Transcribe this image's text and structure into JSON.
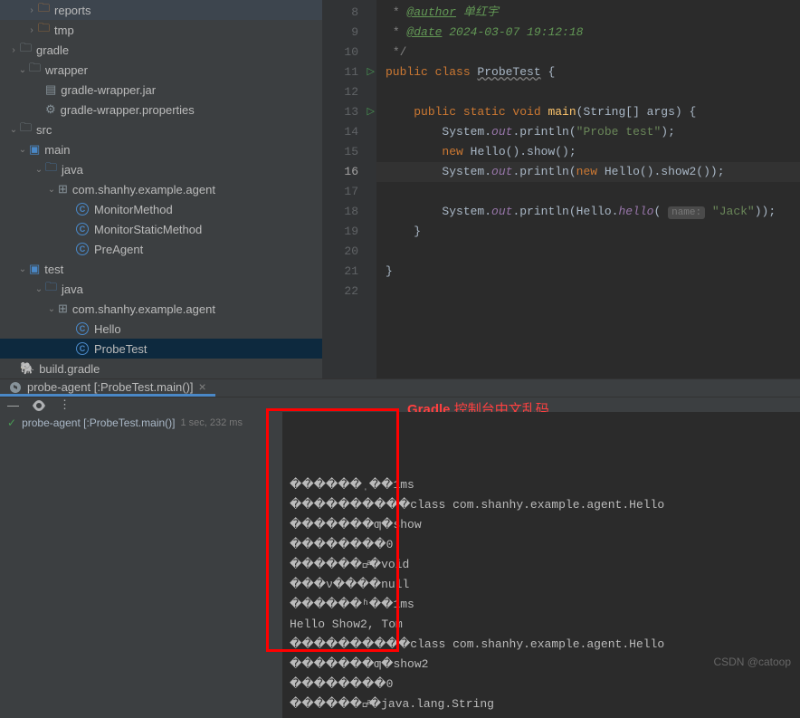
{
  "sidebar": {
    "items": [
      {
        "indent": 20,
        "chevron": "›",
        "icon": "folder-orange",
        "label": "reports"
      },
      {
        "indent": 20,
        "chevron": "›",
        "icon": "folder-orange",
        "label": "tmp"
      },
      {
        "indent": 0,
        "chevron": "›",
        "icon": "folder",
        "label": "gradle"
      },
      {
        "indent": 10,
        "chevron": "⌄",
        "icon": "folder",
        "label": "wrapper"
      },
      {
        "indent": 28,
        "chevron": "",
        "icon": "file",
        "label": "gradle-wrapper.jar"
      },
      {
        "indent": 28,
        "chevron": "",
        "icon": "gear",
        "label": "gradle-wrapper.properties"
      },
      {
        "indent": 0,
        "chevron": "⌄",
        "icon": "folder",
        "label": "src"
      },
      {
        "indent": 10,
        "chevron": "⌄",
        "icon": "module",
        "label": "main"
      },
      {
        "indent": 28,
        "chevron": "⌄",
        "icon": "folder-blue",
        "label": "java"
      },
      {
        "indent": 42,
        "chevron": "⌄",
        "icon": "package",
        "label": "com.shanhy.example.agent"
      },
      {
        "indent": 62,
        "chevron": "",
        "icon": "class",
        "label": "MonitorMethod"
      },
      {
        "indent": 62,
        "chevron": "",
        "icon": "class",
        "label": "MonitorStaticMethod"
      },
      {
        "indent": 62,
        "chevron": "",
        "icon": "class",
        "label": "PreAgent"
      },
      {
        "indent": 10,
        "chevron": "⌄",
        "icon": "module",
        "label": "test"
      },
      {
        "indent": 28,
        "chevron": "⌄",
        "icon": "folder-blue",
        "label": "java"
      },
      {
        "indent": 42,
        "chevron": "⌄",
        "icon": "package",
        "label": "com.shanhy.example.agent"
      },
      {
        "indent": 62,
        "chevron": "",
        "icon": "class",
        "label": "Hello"
      },
      {
        "indent": 62,
        "chevron": "",
        "icon": "class",
        "label": "ProbeTest",
        "selected": true
      },
      {
        "indent": 0,
        "chevron": "",
        "icon": "gradle",
        "label": "build.gradle"
      }
    ]
  },
  "editor": {
    "lines": [
      {
        "num": 8,
        "run": false,
        "html": " <span class='comment'>* </span><span class='doctag'>@author</span><span class='docauthor'> 单红宇</span>"
      },
      {
        "num": 9,
        "run": false,
        "html": " <span class='comment'>* </span><span class='doctag'>@date</span><span class='docauthor'> 2024-03-07 19:12:18</span>"
      },
      {
        "num": 10,
        "run": false,
        "html": " <span class='comment'>*/</span>"
      },
      {
        "num": 11,
        "run": true,
        "html": "<span class='kw'>public class </span><span class='underline-wavy'>ProbeTest</span> {"
      },
      {
        "num": 12,
        "run": false,
        "html": ""
      },
      {
        "num": 13,
        "run": true,
        "html": "    <span class='kw'>public static void </span><span class='method'>main</span>(String[] args) {"
      },
      {
        "num": 14,
        "run": false,
        "html": "        System.<span class='field'>out</span>.println(<span class='str'>\"Probe test\"</span>);"
      },
      {
        "num": 15,
        "run": false,
        "html": "        <span class='kw'>new </span>Hello().show();"
      },
      {
        "num": 16,
        "run": false,
        "html": "        System.<span class='field'>out</span>.println(<span class='kw'>new </span>Hello().show2());",
        "current": true
      },
      {
        "num": 17,
        "run": false,
        "html": ""
      },
      {
        "num": 18,
        "run": false,
        "html": "        System.<span class='field'>out</span>.println(Hello.<span class='field'>hello</span>( <span class='param-hint'>name:</span> <span class='str'>\"Jack\"</span>));"
      },
      {
        "num": 19,
        "run": false,
        "html": "    }"
      },
      {
        "num": 20,
        "run": false,
        "html": ""
      },
      {
        "num": 21,
        "run": false,
        "html": "}"
      },
      {
        "num": 22,
        "run": false,
        "html": ""
      }
    ]
  },
  "tab": {
    "label": "probe-agent [:ProbeTest.main()]"
  },
  "annotation": "Gradle 控制台中文乱码",
  "console": {
    "task": "probe-agent [:ProbeTest.main()]",
    "time": "1 sec, 232 ms",
    "output": [
      "������ˌ��1ms",
      "����������class com.shanhy.example.agent.Hello",
      "�������ƣ�show",
      "��������0",
      "�������ͣ�void",
      "���ν����null",
      "������ʱ��1ms",
      "Hello Show2, Tom",
      "����������class com.shanhy.example.agent.Hello",
      "�������ƣ�show2",
      "��������0",
      "�������ͣ�java.lang.String"
    ]
  },
  "watermark": "CSDN @catoop"
}
